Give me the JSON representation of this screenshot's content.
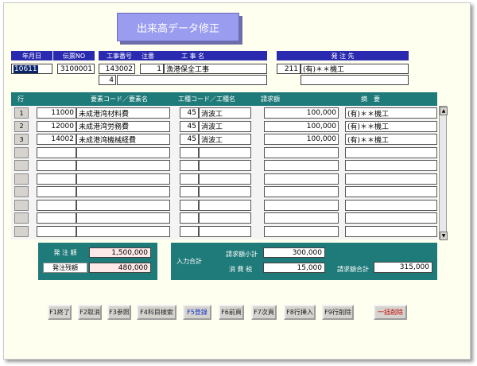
{
  "title": "出来高データ修正",
  "header": {
    "date_label": "年月日",
    "date_value": "10611",
    "order_no_label": "伝票NO",
    "order_no_value": "3100001",
    "work_no_label": "工事番号",
    "work_no_value": "143002",
    "work_no_sub": "4",
    "note_label": "注番",
    "note_value": "1",
    "work_name_label": "工 事 名",
    "work_name_value": "漁港保全工事",
    "supplier_label": "発 注 先",
    "supplier_code": "211",
    "supplier_name": "(有)＊＊機工"
  },
  "grid": {
    "columns": {
      "row": "行",
      "code": "要素コード／要素名",
      "kind": "工種コード／工種名",
      "amount": "請求額",
      "memo": "摘　要"
    },
    "rows": [
      {
        "no": "1",
        "code": "11000",
        "name": "未成港湾材料費",
        "kcode": "45",
        "kname": "消波工",
        "amount": "100,000",
        "memo": "(有)＊＊機工"
      },
      {
        "no": "2",
        "code": "12000",
        "name": "未成港湾労務費",
        "kcode": "45",
        "kname": "消波工",
        "amount": "100,000",
        "memo": "(有)＊＊機工"
      },
      {
        "no": "3",
        "code": "14002",
        "name": "未成港湾機械経費",
        "kcode": "45",
        "kname": "消波工",
        "amount": "100,000",
        "memo": "(有)＊＊機工"
      },
      {
        "no": "",
        "code": "",
        "name": "",
        "kcode": "",
        "kname": "",
        "amount": "",
        "memo": ""
      },
      {
        "no": "",
        "code": "",
        "name": "",
        "kcode": "",
        "kname": "",
        "amount": "",
        "memo": ""
      },
      {
        "no": "",
        "code": "",
        "name": "",
        "kcode": "",
        "kname": "",
        "amount": "",
        "memo": ""
      },
      {
        "no": "",
        "code": "",
        "name": "",
        "kcode": "",
        "kname": "",
        "amount": "",
        "memo": ""
      },
      {
        "no": "",
        "code": "",
        "name": "",
        "kcode": "",
        "kname": "",
        "amount": "",
        "memo": ""
      },
      {
        "no": "",
        "code": "",
        "name": "",
        "kcode": "",
        "kname": "",
        "amount": "",
        "memo": ""
      },
      {
        "no": "",
        "code": "",
        "name": "",
        "kcode": "",
        "kname": "",
        "amount": "",
        "memo": ""
      }
    ]
  },
  "totals": {
    "order_amount_label": "発 注 額",
    "order_amount": "1,500,000",
    "order_balance_label": "発注残額",
    "order_balance": "480,000",
    "input_total_label": "入力合計",
    "subtotal_label": "請求額小計",
    "subtotal": "300,000",
    "tax_label": "消 費 税",
    "tax": "15,000",
    "grand_label": "請求額合計",
    "grand": "315,000"
  },
  "fkeys": [
    "F1終了",
    "F2取消",
    "F3参照",
    "F4科目検索",
    "F5登録",
    "F6前頁",
    "F7次頁",
    "F8行挿入",
    "F9行削除",
    "一括削除"
  ]
}
